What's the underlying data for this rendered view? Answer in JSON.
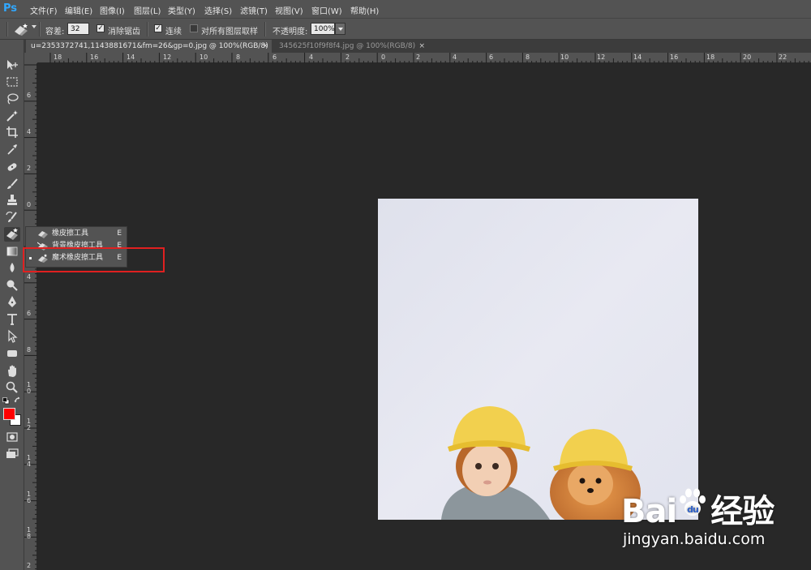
{
  "app": {
    "logo": "Ps"
  },
  "menu": [
    "文件(F)",
    "编辑(E)",
    "图像(I)",
    "图层(L)",
    "类型(Y)",
    "选择(S)",
    "滤镜(T)",
    "视图(V)",
    "窗口(W)",
    "帮助(H)"
  ],
  "options": {
    "tolerance_label": "容差:",
    "tolerance_value": "32",
    "antialias_label": "消除锯齿",
    "contiguous_label": "连续",
    "sample_all_label": "对所有图层取样",
    "opacity_label": "不透明度:",
    "opacity_value": "100%"
  },
  "tabs": [
    {
      "label": "u=2353372741,1143881671&fm=26&gp=0.jpg @ 100%(RGB/8)",
      "close": "×"
    },
    {
      "label": "345625f10f9f8f4.jpg @ 100%(RGB/8)",
      "close": "×"
    }
  ],
  "hruler": [
    "18",
    "16",
    "14",
    "12",
    "10",
    "8",
    "6",
    "4",
    "2",
    "0",
    "2",
    "4",
    "6",
    "8",
    "10",
    "12",
    "14",
    "16",
    "18",
    "20",
    "22"
  ],
  "vruler": [
    "6",
    "4",
    "2",
    "0",
    "2",
    "4",
    "6",
    "8",
    "1 0",
    "1 2",
    "1 4",
    "1 6",
    "1 8",
    "2"
  ],
  "flyout": [
    {
      "label": "橡皮擦工具",
      "key": "E",
      "icon": "eraser-icon"
    },
    {
      "label": "背景橡皮擦工具",
      "key": "E",
      "icon": "background-eraser-icon"
    },
    {
      "label": "魔术橡皮擦工具",
      "key": "E",
      "icon": "magic-eraser-icon"
    }
  ],
  "colors": {
    "foreground": "#ff0000",
    "background": "#ffffff",
    "highlight": "#e02020"
  },
  "watermark": {
    "main": "Bai",
    "main2": "经验",
    "sub": "jingyan.baidu.com"
  }
}
